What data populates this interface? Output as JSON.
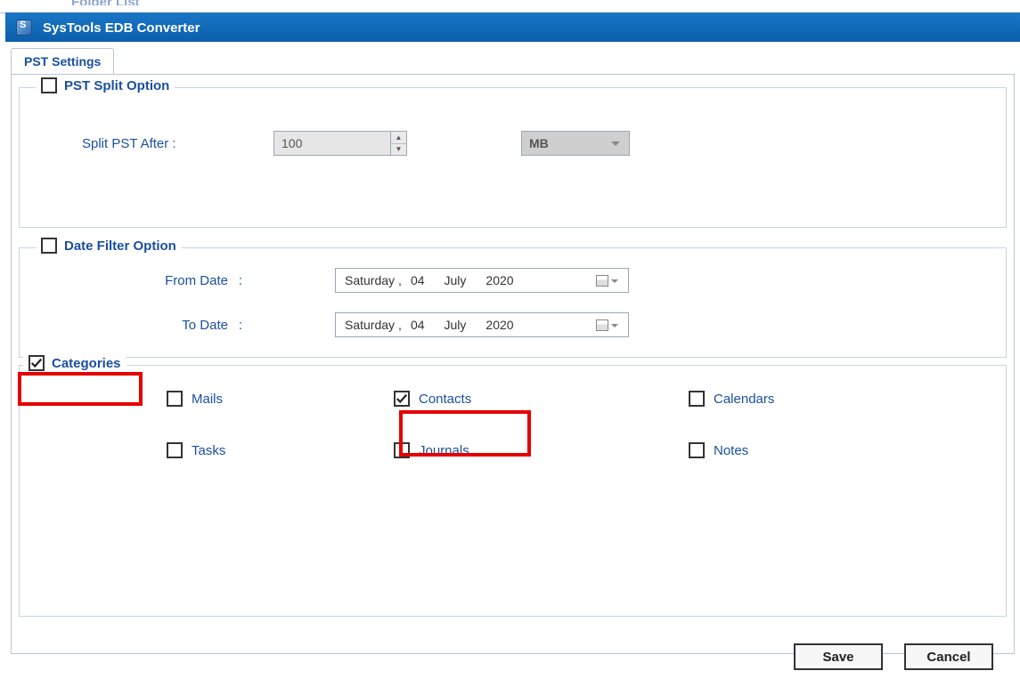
{
  "bg": {
    "folder_list": "Folder List"
  },
  "window": {
    "title": "SysTools  EDB Converter"
  },
  "tab": {
    "label": "PST Settings"
  },
  "split": {
    "legend": "PST Split Option",
    "label": "Split PST After :",
    "value": "100",
    "unit": "MB",
    "checked": false
  },
  "datefilter": {
    "legend": "Date Filter Option",
    "checked": false,
    "from_label": "From Date",
    "to_label": "To Date",
    "from": {
      "weekday": "Saturday",
      "sep": ",",
      "day": "04",
      "month": "July",
      "year": "2020"
    },
    "to": {
      "weekday": "Saturday",
      "sep": ",",
      "day": "04",
      "month": "July",
      "year": "2020"
    }
  },
  "categories": {
    "legend": "Categories",
    "checked": true,
    "items": [
      {
        "label": "Mails",
        "checked": false
      },
      {
        "label": "Contacts",
        "checked": true
      },
      {
        "label": "Calendars",
        "checked": false
      },
      {
        "label": "Tasks",
        "checked": false
      },
      {
        "label": "Journals",
        "checked": false
      },
      {
        "label": "Notes",
        "checked": false
      }
    ]
  },
  "buttons": {
    "save": "Save",
    "cancel": "Cancel"
  }
}
